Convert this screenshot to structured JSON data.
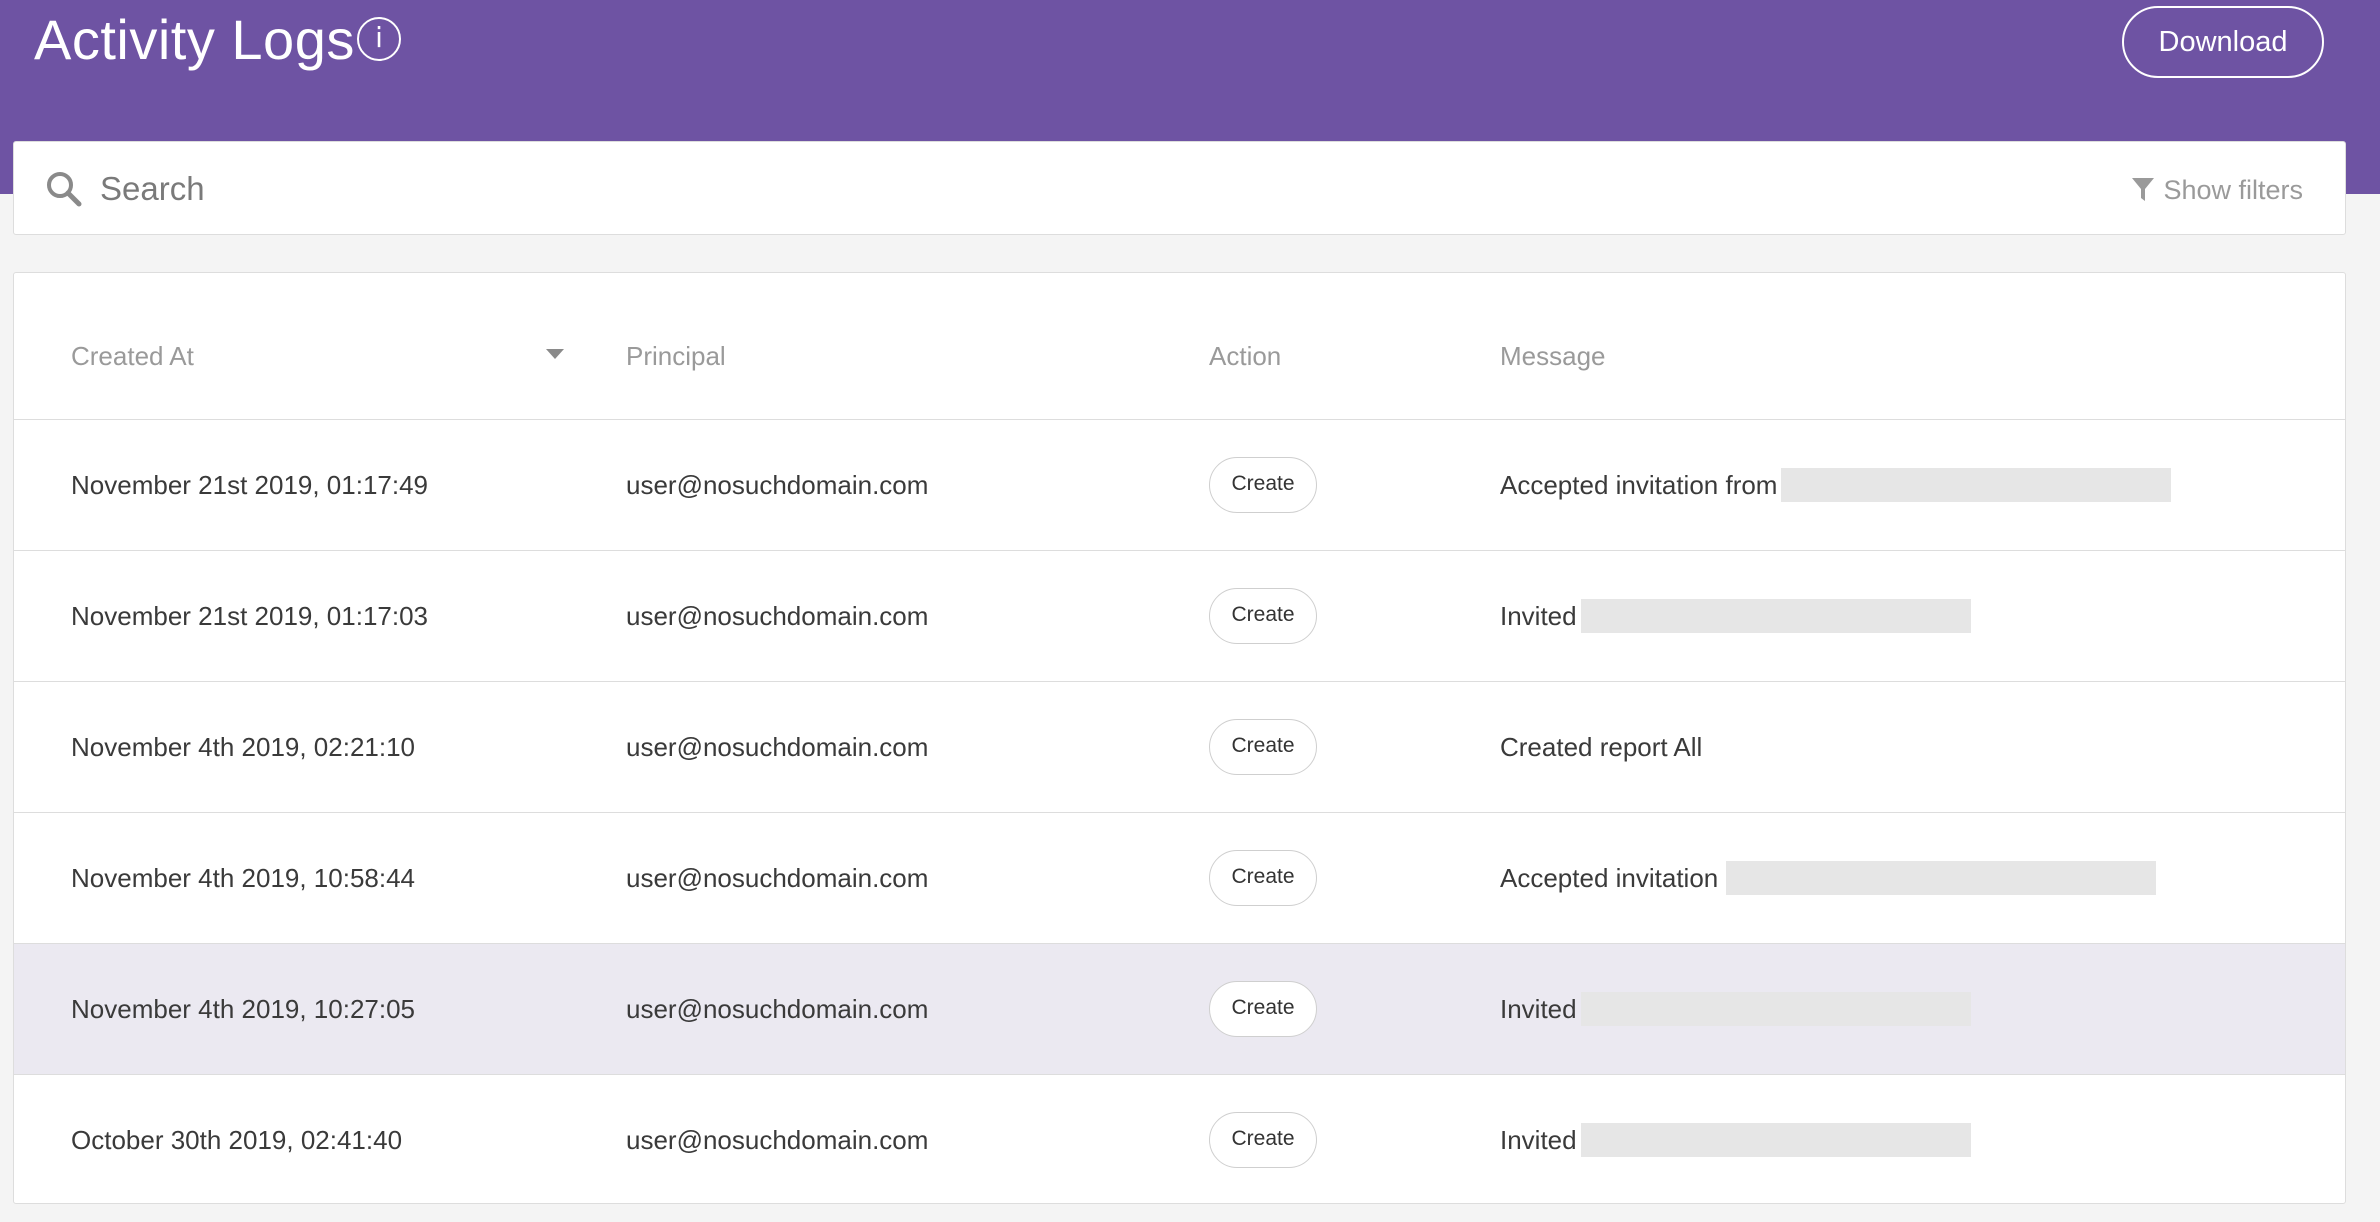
{
  "header": {
    "title": "Activity Logs",
    "info_icon": "i",
    "download_label": "Download",
    "color": "#6e53a3"
  },
  "search": {
    "placeholder": "Search",
    "filters_label": "Show filters"
  },
  "table": {
    "columns": [
      "Created At",
      "Principal",
      "Action",
      "Message"
    ],
    "sort_column": "Created At",
    "rows": [
      {
        "created_at": "November 21st 2019, 01:17:49",
        "principal": "user@nosuchdomain.com",
        "action": "Create",
        "message": "Accepted invitation from"
      },
      {
        "created_at": "November 21st 2019, 01:17:03",
        "principal": "user@nosuchdomain.com",
        "action": "Create",
        "message": "Invited"
      },
      {
        "created_at": "November 4th 2019, 02:21:10",
        "principal": "user@nosuchdomain.com",
        "action": "Create",
        "message": "Created report All"
      },
      {
        "created_at": "November 4th 2019, 10:58:44",
        "principal": "user@nosuchdomain.com",
        "action": "Create",
        "message": "Accepted invitation"
      },
      {
        "created_at": "November 4th 2019, 10:27:05",
        "principal": "user@nosuchdomain.com",
        "action": "Create",
        "message": "Invited"
      },
      {
        "created_at": "October 30th 2019, 02:41:40",
        "principal": "user@nosuchdomain.com",
        "action": "Create",
        "message": "Invited"
      }
    ]
  }
}
